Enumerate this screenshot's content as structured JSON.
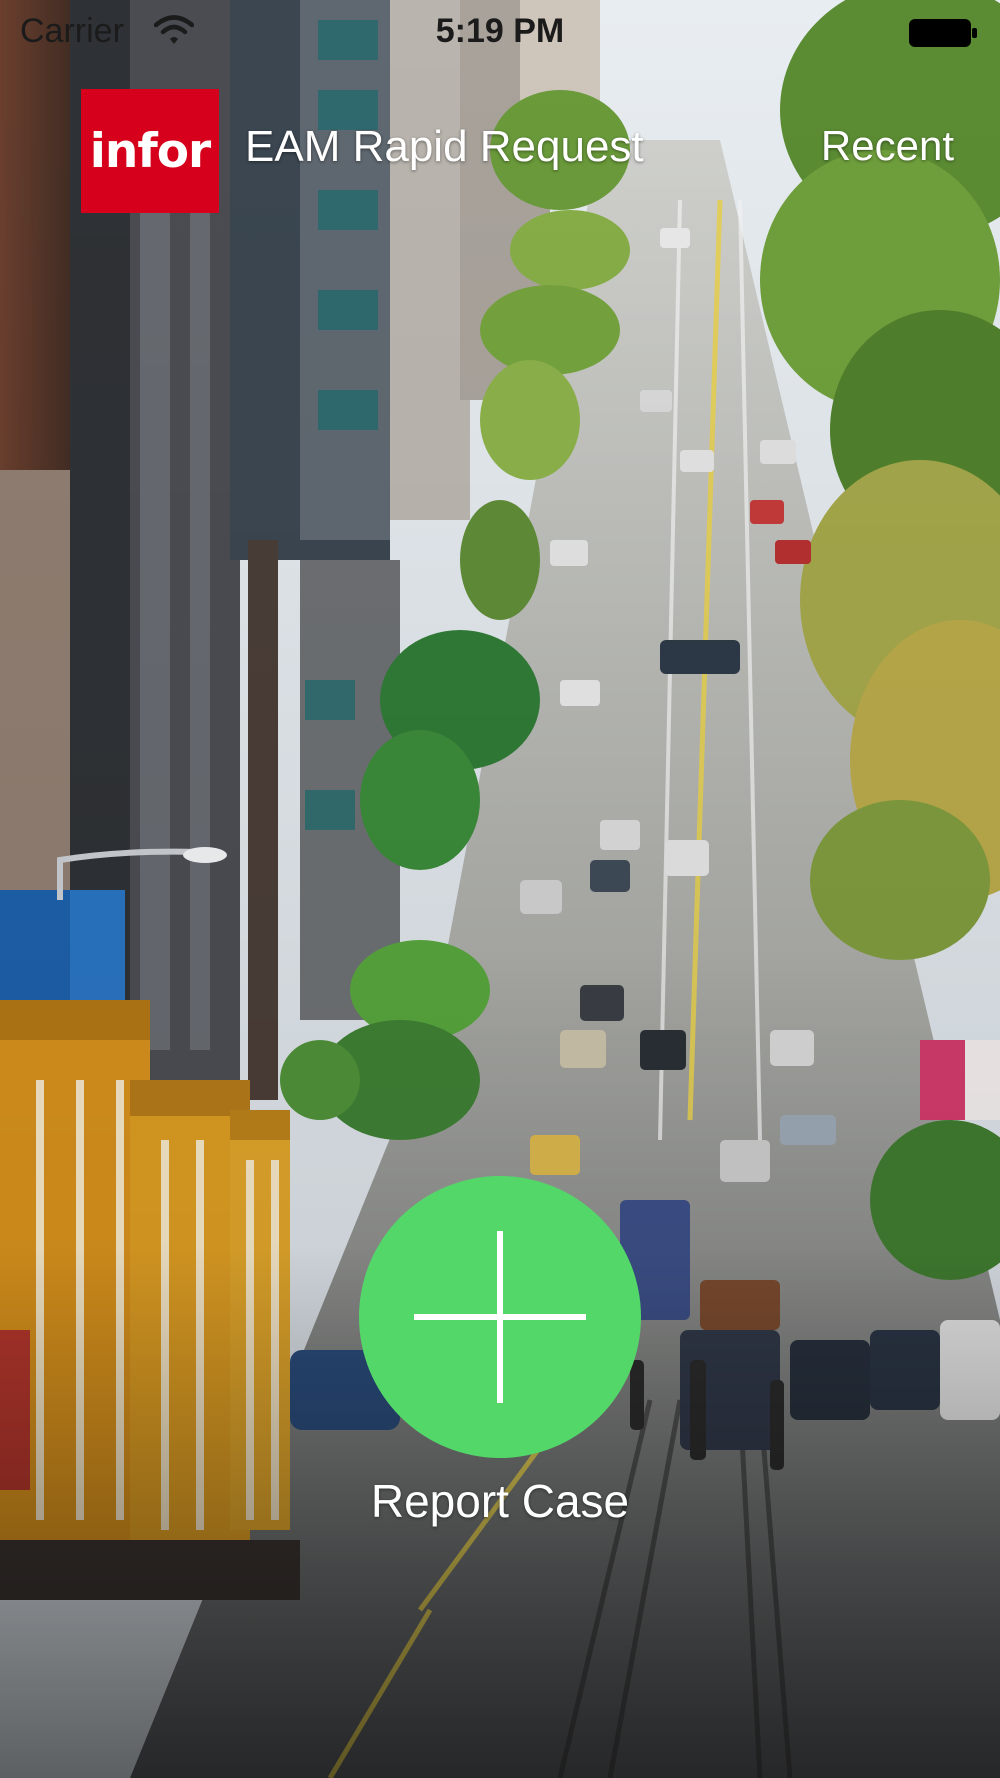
{
  "status_bar": {
    "carrier": "Carrier",
    "time": "5:19 PM",
    "wifi_icon": "wifi-icon",
    "battery_icon": "battery-icon"
  },
  "header": {
    "logo_text": "infor",
    "title": "EAM Rapid Request",
    "recent_label": "Recent"
  },
  "main": {
    "report_icon": "plus-icon",
    "report_label": "Report Case"
  },
  "colors": {
    "brand_red": "#d6001c",
    "report_green": "#53d769"
  }
}
